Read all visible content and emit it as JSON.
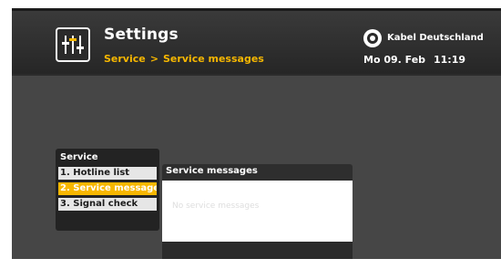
{
  "header": {
    "title": "Settings",
    "breadcrumb": {
      "parent": "Service",
      "separator": ">",
      "current": "Service messages"
    },
    "brand_name": "Kabel Deutschland",
    "date": "Mo 09. Feb",
    "time": "11:19",
    "icon": "settings-sliders-icon",
    "brand_icon": "kabel-deutschland-logo"
  },
  "menu": {
    "title": "Service",
    "items": [
      {
        "label": "1. Hotline list",
        "selected": false
      },
      {
        "label": "2. Service messages",
        "selected": true
      },
      {
        "label": "3. Signal check",
        "selected": false
      }
    ]
  },
  "content": {
    "title": "Service messages",
    "empty_text": "No service messages"
  },
  "colors": {
    "accent": "#f7b700",
    "background": "#464646",
    "panel": "#232323",
    "item": "#e6e6e6"
  }
}
